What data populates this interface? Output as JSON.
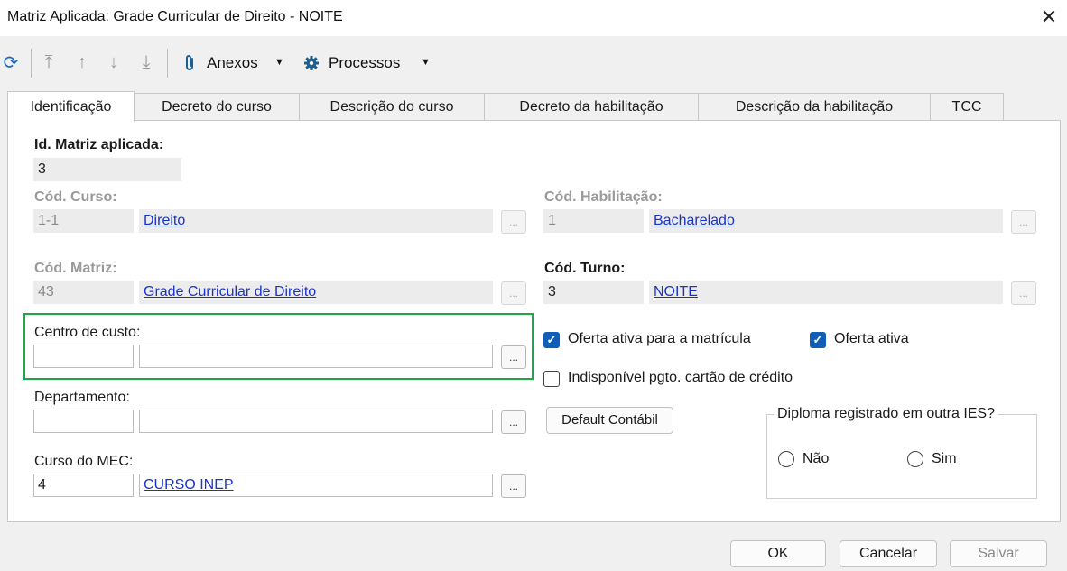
{
  "window": {
    "title": "Matriz Aplicada: Grade Curricular de Direito - NOITE",
    "close_glyph": "✕"
  },
  "toolbar": {
    "refresh_icon": "refresh-icon",
    "first_icon": "move-to-top-icon",
    "up_icon": "move-up-icon",
    "down_icon": "move-down-icon",
    "last_icon": "move-to-bottom-icon",
    "anexos_label": "Anexos",
    "processos_label": "Processos",
    "caret": "▼"
  },
  "tabs": [
    {
      "label": "Identificação"
    },
    {
      "label": "Decreto do curso"
    },
    {
      "label": "Descrição do curso"
    },
    {
      "label": "Decreto da habilitação"
    },
    {
      "label": "Descrição da habilitação"
    },
    {
      "label": "TCC"
    }
  ],
  "form": {
    "id_matriz": {
      "label": "Id. Matriz aplicada:",
      "value": "3"
    },
    "cod_curso": {
      "label": "Cód. Curso:",
      "code": "1-1",
      "name": "Direito"
    },
    "cod_habilitacao": {
      "label": "Cód. Habilitação:",
      "code": "1",
      "name": "Bacharelado"
    },
    "cod_matriz": {
      "label": "Cód. Matriz:",
      "code": "43",
      "name": "Grade Curricular de Direito"
    },
    "cod_turno": {
      "label": "Cód. Turno:",
      "code": "3",
      "name": "NOITE"
    },
    "centro_custo": {
      "label": "Centro de custo:",
      "code": "",
      "name": ""
    },
    "departamento": {
      "label": "Departamento:",
      "code": "",
      "name": ""
    },
    "curso_mec": {
      "label": "Curso do MEC:",
      "code": "4",
      "name": "CURSO INEP"
    },
    "lookup_label": "...",
    "oferta_matricula": {
      "label": "Oferta ativa para a matrícula",
      "checked": true
    },
    "oferta_ativa": {
      "label": "Oferta ativa",
      "checked": true
    },
    "indisponivel_cartao": {
      "label": "Indisponível pgto. cartão de crédito",
      "checked": false
    },
    "default_contabil_label": "Default Contábil",
    "diploma": {
      "legend": "Diploma registrado em outra IES?",
      "options": [
        "Não",
        "Sim"
      ]
    }
  },
  "footer": {
    "ok_label": "OK",
    "cancel_label": "Cancelar",
    "save_label": "Salvar"
  },
  "colors": {
    "highlight": "#1fa84a",
    "checkbox": "#0f5fb8",
    "link": "#1a33cc"
  }
}
